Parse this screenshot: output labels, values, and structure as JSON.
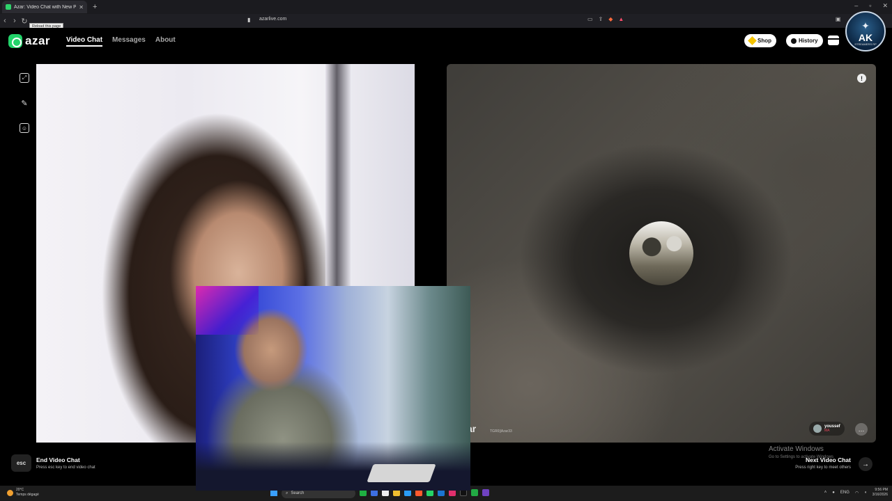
{
  "browser": {
    "tab_title": "Azar: Video Chat with New People",
    "url": "azarlive.com",
    "tooltip": "Reload this page"
  },
  "azar": {
    "logo_text": "azar",
    "nav": {
      "video_chat": "Video Chat",
      "messages": "Messages",
      "about": "About"
    },
    "shop_label": "Shop",
    "history_label": "History",
    "badge": {
      "title": "AK",
      "sub": "STREAMERS RP"
    }
  },
  "remote": {
    "username": "youssef",
    "country": "MA",
    "watermark": "zar",
    "watermark_sub": "TGR0||Azar33"
  },
  "controls": {
    "esc_key": "esc",
    "end_title": "End Video Chat",
    "end_sub": "Press esc key to end video chat",
    "next_title": "Next Video Chat",
    "next_sub": "Press right key to meet others"
  },
  "windows": {
    "activate_title": "Activate Windows",
    "activate_sub": "Go to Settings to activate Windows",
    "weather_temp": "20°C",
    "weather_desc": "Temps dégagé",
    "search_label": "Search",
    "lang": "ENG",
    "time": "9:56 PM",
    "date": "3/16/2026"
  },
  "colors": {
    "brand_green": "#22d36a",
    "shop_gem": "#f5c400"
  },
  "icons": [
    "back-icon",
    "forward-icon",
    "reload-icon",
    "bookmark-icon",
    "share-icon",
    "brave-icon",
    "expand-icon",
    "wand-icon",
    "sticker-icon",
    "report-icon",
    "chat-icon",
    "arrow-right-icon"
  ]
}
